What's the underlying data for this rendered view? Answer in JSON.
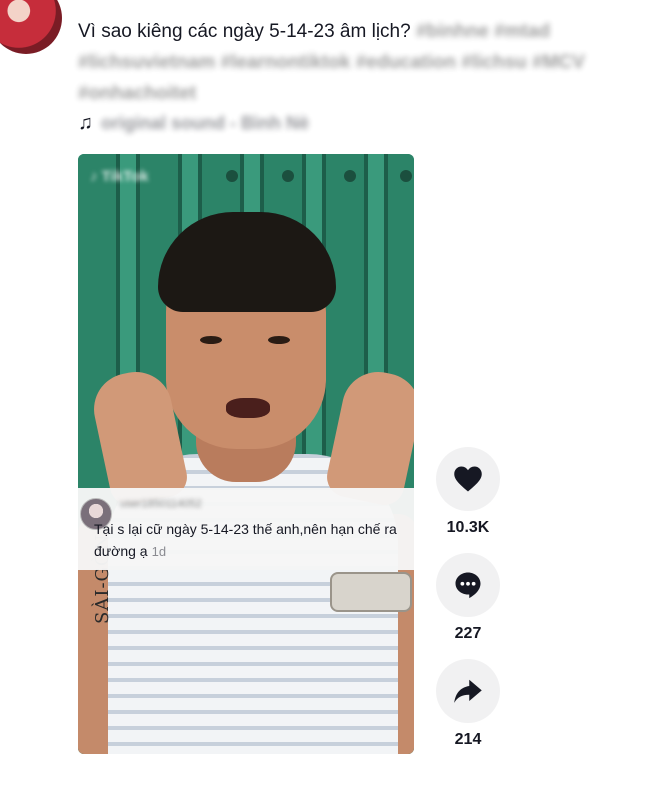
{
  "post": {
    "caption": "Vì sao kiêng các ngày 5-14-23 âm lịch?",
    "hashtags_line1": "#binhne #mtad",
    "hashtags_line2": "#lichsuvietnam #learnontiktok #education #lichsu #MCV",
    "hashtags_line3": "#onhachoitet",
    "sound": "original sound - Bình Nè"
  },
  "video": {
    "tattoo_text": "SÀI-GÒN"
  },
  "comment": {
    "text": "Tại s lại cữ ngày 5-14-23 thế anh,nên hạn chế ra đường ạ",
    "time": "1d"
  },
  "actions": {
    "likes": "10.3K",
    "comments": "227",
    "shares": "214"
  },
  "icons": {
    "music": "music-note-icon",
    "like": "heart-icon",
    "comment": "comment-icon",
    "share": "share-icon"
  }
}
